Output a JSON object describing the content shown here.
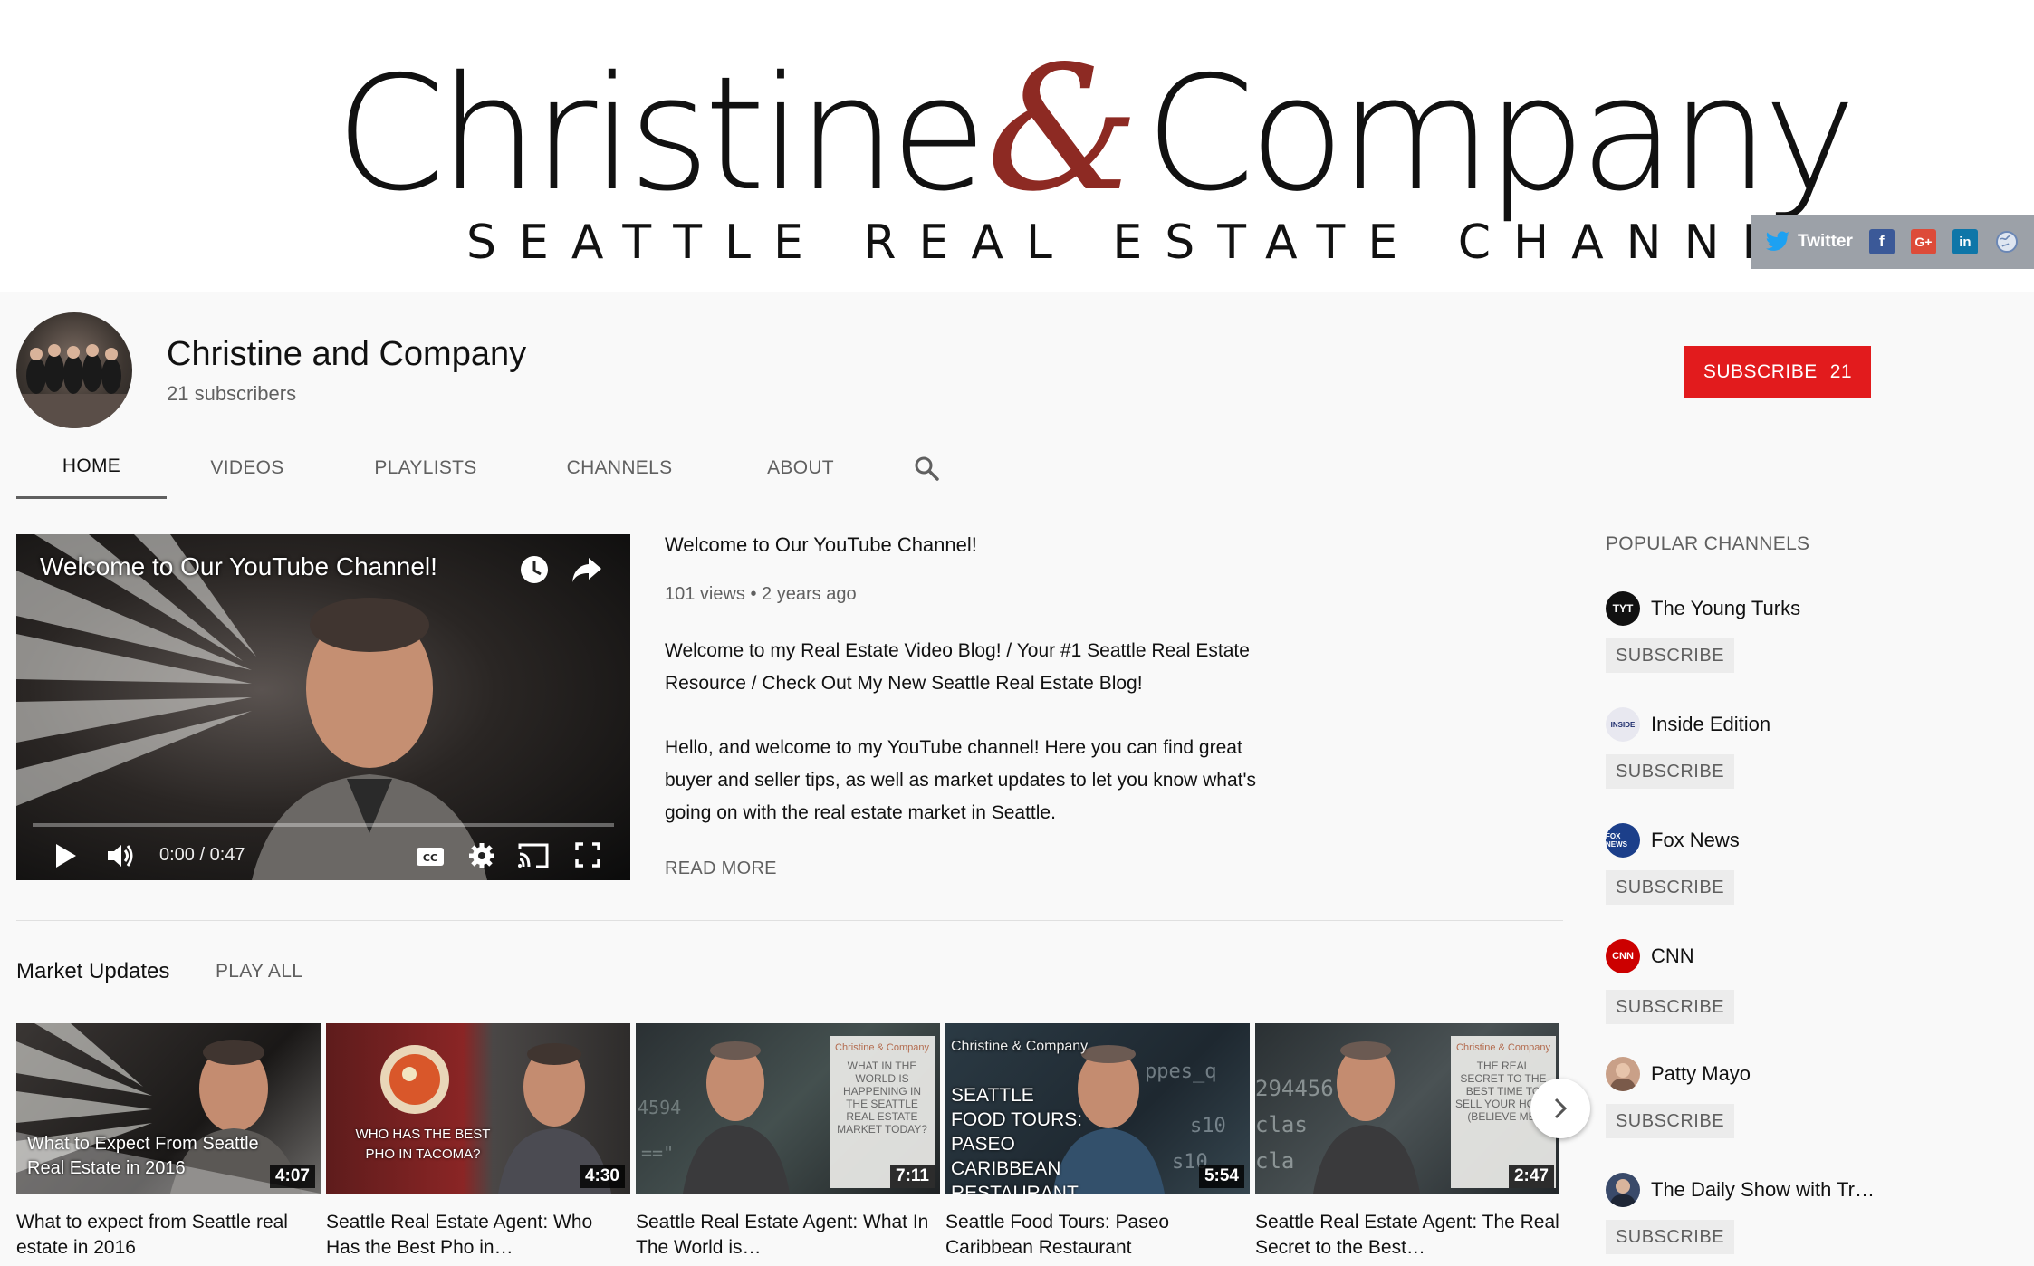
{
  "banner": {
    "logo_left": "Christine",
    "logo_amp": "&",
    "logo_right": "Company",
    "tagline": "SEATTLE REAL ESTATE CHANNEL",
    "social": {
      "twitter": "Twitter",
      "facebook": "f",
      "google": "G+",
      "linkedin": "in"
    }
  },
  "channel": {
    "title": "Christine and Company",
    "subscribers": "21 subscribers",
    "subscribe_label": "SUBSCRIBE",
    "subscribe_count": "21"
  },
  "tabs": [
    {
      "label": "HOME",
      "active": true
    },
    {
      "label": "VIDEOS"
    },
    {
      "label": "PLAYLISTS"
    },
    {
      "label": "CHANNELS"
    },
    {
      "label": "ABOUT"
    }
  ],
  "featured": {
    "player_title": "Welcome to Our YouTube Channel!",
    "time": "0:00 / 0:47",
    "title": "Welcome to Our YouTube Channel!",
    "meta": "101 views • 2 years ago",
    "desc1": "Welcome to my Real Estate Video Blog! / Your #1 Seattle Real Estate Resource / Check Out My New Seattle Real Estate Blog!",
    "desc2": "Hello, and welcome to my YouTube channel! Here you can find great buyer and seller tips, as well as market updates to let you know what's going on with the real estate market in Seattle.",
    "read_more": "READ MORE"
  },
  "shelf": {
    "title": "Market Updates",
    "play_all": "PLAY ALL",
    "videos": [
      {
        "title": "What to expect from Seattle real estate in 2016",
        "duration": "4:07",
        "overlay": "What to Expect From Seattle Real Estate in 2016"
      },
      {
        "title": "Seattle Real Estate Agent: Who Has the Best Pho in…",
        "duration": "4:30",
        "overlay": "WHO HAS THE BEST PHO IN TACOMA?"
      },
      {
        "title": "Seattle Real Estate Agent: What In The World is…",
        "duration": "7:11",
        "overlay": "WHAT IN THE WORLD IS HAPPENING IN THE SEATTLE REAL ESTATE MARKET TODAY?"
      },
      {
        "title": "Seattle Food Tours: Paseo Caribbean Restaurant",
        "duration": "5:54",
        "overlay": "SEATTLE FOOD TOURS: PASEO CARIBBEAN RESTAURANT"
      },
      {
        "title": "Seattle Real Estate Agent: The Real Secret to the Best…",
        "duration": "2:47",
        "overlay": "THE REAL SECRET TO THE BEST TIME TO SELL YOUR HOME (BELIEVE ME)"
      }
    ],
    "thumb_brand": "Christine & Company"
  },
  "popular": {
    "title": "POPULAR CHANNELS",
    "subscribe_label": "SUBSCRIBE",
    "channels": [
      {
        "name": "The Young Turks",
        "icon": "TYT",
        "color": "#111111"
      },
      {
        "name": "Inside Edition",
        "icon": "INSIDE",
        "color": "#e8e8f0"
      },
      {
        "name": "Fox News",
        "icon": "FOX NEWS",
        "color": "#1c3f8a"
      },
      {
        "name": "CNN",
        "icon": "CNN",
        "color": "#cc0000"
      },
      {
        "name": "Patty Mayo",
        "icon": "person-avatar",
        "color": "#c9a088"
      },
      {
        "name": "The Daily Show with Tr…",
        "icon": "person-avatar",
        "color": "#3a4a6a"
      }
    ]
  }
}
